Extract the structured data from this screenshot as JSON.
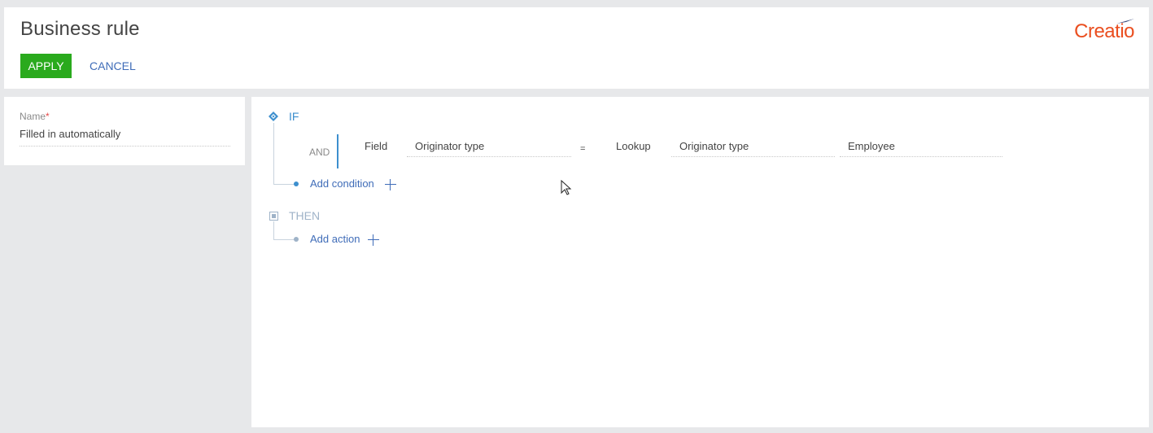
{
  "header": {
    "title": "Business rule",
    "apply_label": "APPLY",
    "cancel_label": "CANCEL",
    "logo_text": "Creatio",
    "logo_color": "#ea4e1f",
    "apply_color": "#2aaa1d"
  },
  "left_panel": {
    "name_label": "Name",
    "required_mark": "*",
    "name_value": "Filled in automatically"
  },
  "rule": {
    "if_label": "IF",
    "condition": {
      "logic": "AND",
      "field_label": "Field",
      "field_value": "Originator type",
      "operator": "=",
      "compare_type_label": "Lookup",
      "compare_field_value": "Originator type",
      "compare_value": "Employee"
    },
    "add_condition_label": "Add condition",
    "then_label": "THEN",
    "add_action_label": "Add action",
    "accent_color": "#3d8fce"
  }
}
